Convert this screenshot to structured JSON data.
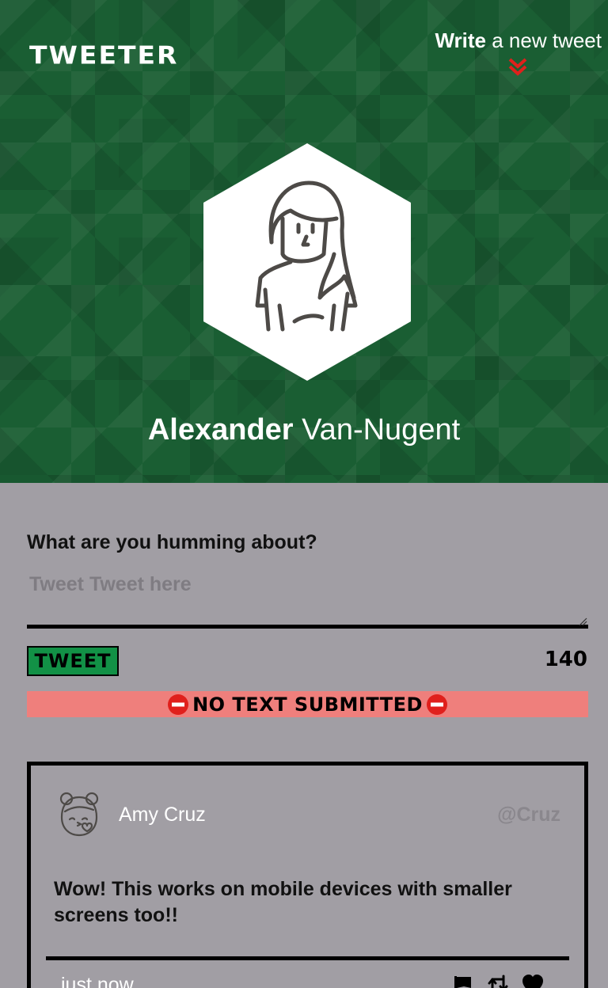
{
  "header": {
    "brand": "TWEETER",
    "write_bold": "Write",
    "write_rest": " a new tweet"
  },
  "profile": {
    "first_name": "Alexander",
    "last_name": "Van-Nugent"
  },
  "compose": {
    "label": "What are you humming about?",
    "placeholder": "Tweet Tweet here",
    "button_label": "TWEET",
    "char_count": "140",
    "error_text": "NO TEXT SUBMITTED"
  },
  "tweets": [
    {
      "name": "Amy Cruz",
      "handle": "@Cruz",
      "text": "Wow! This works on mobile devices with smaller screens too!!",
      "time": "just now",
      "actions": [
        "flag-icon",
        "retweet-icon",
        "heart-icon"
      ]
    }
  ],
  "colors": {
    "header_bg": "#1a5e33",
    "page_bg": "#a19ea4",
    "tweet_button": "#129146",
    "error_bg": "#ef7f7c",
    "accent_red": "#e0201c"
  }
}
